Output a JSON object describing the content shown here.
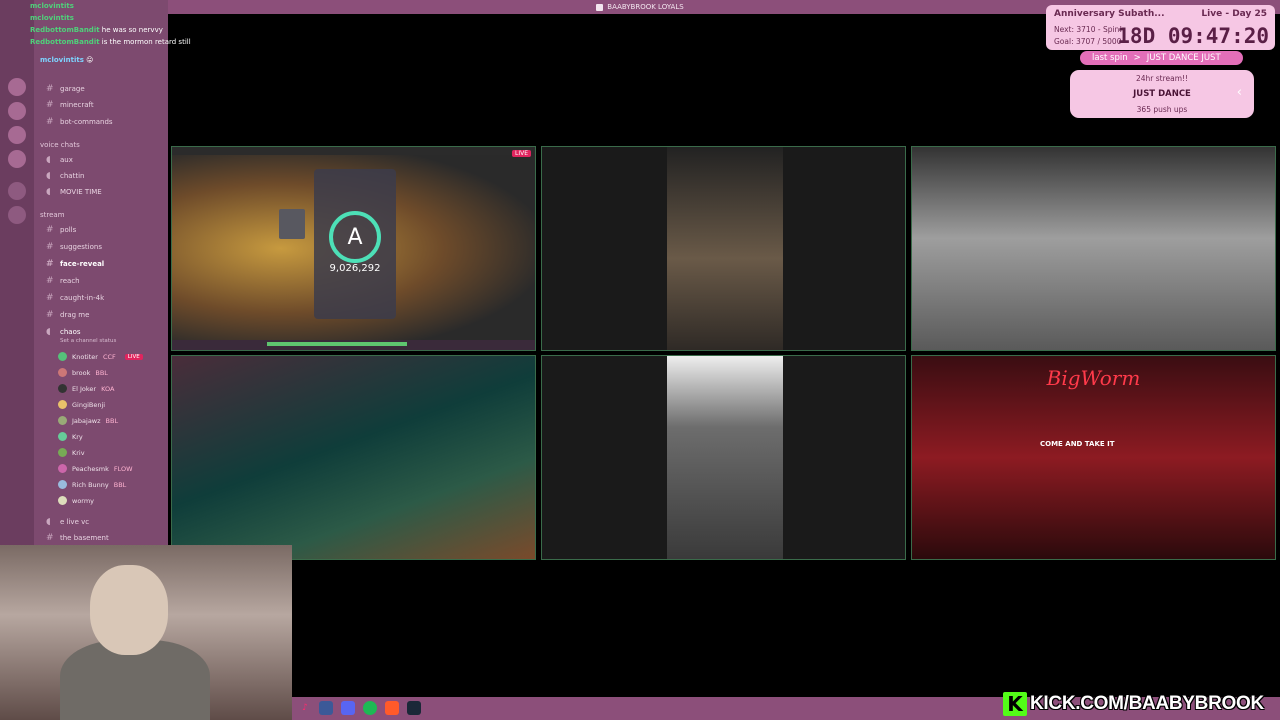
{
  "window_title": "BAABYBROOK LOYALS",
  "chat": [
    {
      "user": "mclovintits",
      "text": ""
    },
    {
      "user": "mclovintits",
      "text": ""
    },
    {
      "user": "RedbottomBandit",
      "text": "he was so nervvy"
    },
    {
      "user": "RedbottomBandit",
      "text": "is the mormon retard still"
    },
    {
      "user": "mclovintits",
      "text": "😛"
    }
  ],
  "sidebar": {
    "channels": [
      {
        "label": "garage"
      },
      {
        "label": "minecraft"
      },
      {
        "label": "bot-commands"
      }
    ],
    "voice_category": "voice chats",
    "voice_channels": [
      {
        "label": "aux"
      },
      {
        "label": "chattin"
      },
      {
        "label": "MOVIE TIME"
      }
    ],
    "stream_category": "stream",
    "stream_channels": [
      {
        "label": "polls"
      },
      {
        "label": "suggestions"
      },
      {
        "label": "face-reveal"
      },
      {
        "label": "reach"
      },
      {
        "label": "caught-in-4k"
      },
      {
        "label": "drag me"
      }
    ],
    "active_voice": "chaos",
    "active_voice_status": "Set a channel status",
    "voice_users": [
      {
        "name": "Knotiter",
        "tag": "CCF",
        "live": "LIVE"
      },
      {
        "name": "brook",
        "tag": "BBL",
        "live": ""
      },
      {
        "name": "El Joker",
        "tag": "KOA",
        "live": ""
      },
      {
        "name": "GingiBenji",
        "tag": "",
        "live": ""
      },
      {
        "name": "Jabajawz",
        "tag": "BBL",
        "live": ""
      },
      {
        "name": "Kry",
        "tag": "",
        "live": ""
      },
      {
        "name": "Kriv",
        "tag": "",
        "live": ""
      },
      {
        "name": "Peachesmk",
        "tag": "FLOW",
        "live": ""
      },
      {
        "name": "Rich Bunny",
        "tag": "BBL",
        "live": ""
      },
      {
        "name": "wormy",
        "tag": "",
        "live": ""
      }
    ],
    "bottom_channels": [
      {
        "label": "e live vc"
      },
      {
        "label": "the basement"
      }
    ]
  },
  "subathon": {
    "title": "Anniversary Subath...",
    "day": "Live - Day 25",
    "next": "Next: 3710 - Spin!",
    "goal": "Goal: 3707 / 5000",
    "timer": "18D 09:47:20"
  },
  "spin": {
    "label": "last spin",
    "arrow": ">",
    "value": "JUST DANCE JUST",
    "list": [
      "24hr stream!!",
      "JUST DANCE",
      "365 push ups"
    ]
  },
  "game": {
    "live": "LIVE",
    "grade": "A",
    "score": "9,026,292"
  },
  "bigworm": {
    "title": "BigWorm",
    "banner": "COME AND TAKE IT"
  },
  "kick_url": "KICK.COM/BAABYBROOK",
  "kick_logo": "K"
}
